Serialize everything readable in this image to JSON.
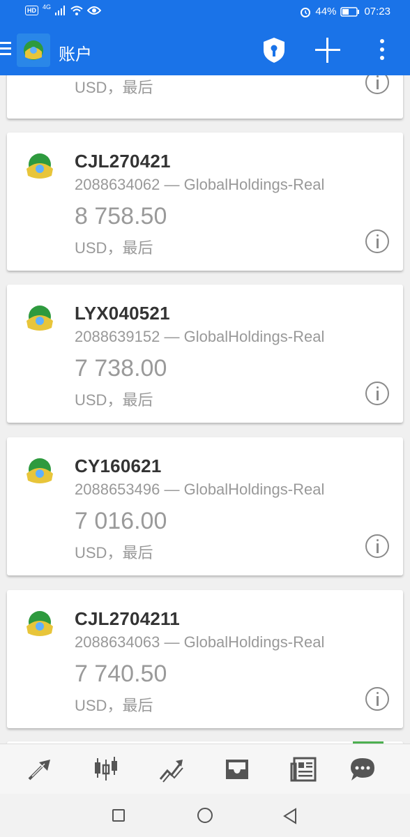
{
  "status_bar": {
    "hd": "HD",
    "network": "4G",
    "battery_percent": "44%",
    "time": "07:23"
  },
  "app_bar": {
    "title": "账户",
    "icons": [
      "menu-icon",
      "app-logo",
      "shield-lock-icon",
      "add-icon",
      "more-vert-icon"
    ]
  },
  "accounts": [
    {
      "name": "",
      "account_server": "",
      "balance": "",
      "currency_line": "USD，最后"
    },
    {
      "name": "CJL270421",
      "account_server": "2088634062 — GlobalHoldings-Real",
      "balance": "8 758.50",
      "currency_line": "USD，最后"
    },
    {
      "name": "LYX040521",
      "account_server": "2088639152 — GlobalHoldings-Real",
      "balance": "7 738.00",
      "currency_line": "USD，最后"
    },
    {
      "name": "CY160621",
      "account_server": "2088653496 — GlobalHoldings-Real",
      "balance": "7 016.00",
      "currency_line": "USD，最后"
    },
    {
      "name": "CJL2704211",
      "account_server": "2088634063 — GlobalHoldings-Real",
      "balance": "7 740.50",
      "currency_line": "USD，最后"
    }
  ],
  "bottom_nav": [
    "quotes-icon",
    "chart-icon",
    "trade-icon",
    "history-icon",
    "news-icon",
    "chat-icon"
  ],
  "system_nav": [
    "recent-apps-icon",
    "home-icon",
    "back-icon"
  ],
  "colors": {
    "primary": "#1a73e8",
    "text_muted": "#999999",
    "accent_green": "#4caf50"
  }
}
